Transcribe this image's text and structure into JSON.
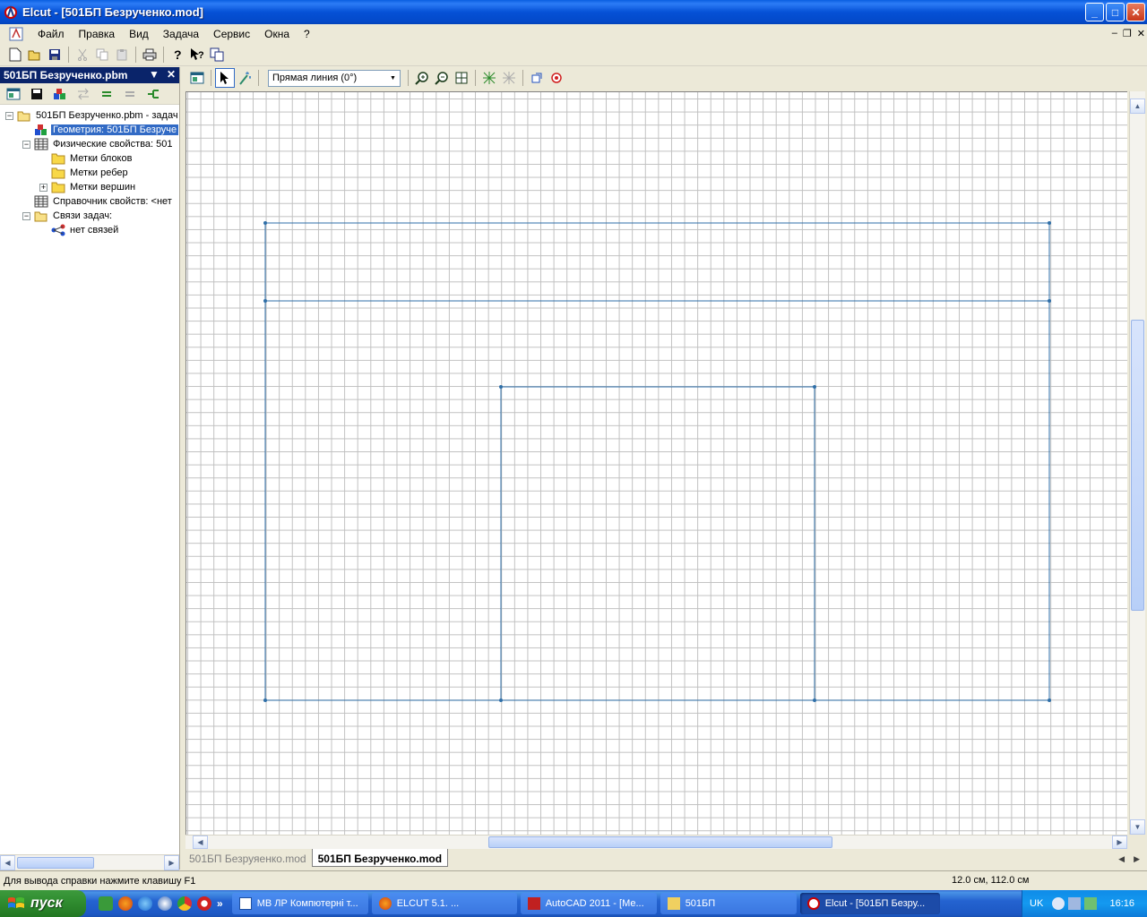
{
  "window": {
    "title": "Elcut - [501БП Безрученко.mod]",
    "controls": {
      "minimize": "_",
      "maximize": "□",
      "close": "✕"
    }
  },
  "menu": {
    "items": [
      "Файл",
      "Правка",
      "Вид",
      "Задача",
      "Сервис",
      "Окна",
      "?"
    ],
    "mdi_controls": {
      "minimize": "–",
      "restore": "❐",
      "close": "✕"
    }
  },
  "left_panel": {
    "title": "501БП Безрученко.pbm",
    "tree": [
      {
        "label": "501БП Безрученко.pbm - задач",
        "level": 0,
        "expander": "−",
        "icon": "folder-open-icon"
      },
      {
        "label": "Геометрия: 501БП Безруче",
        "level": 1,
        "expander": "",
        "icon": "geometry-icon",
        "selected": true
      },
      {
        "label": "Физические свойства: 501",
        "level": 1,
        "expander": "−",
        "icon": "table-icon"
      },
      {
        "label": "Метки блоков",
        "level": 2,
        "expander": "",
        "icon": "folder-icon"
      },
      {
        "label": "Метки ребер",
        "level": 2,
        "expander": "",
        "icon": "folder-icon"
      },
      {
        "label": "Метки вершин",
        "level": 2,
        "expander": "+",
        "icon": "folder-icon"
      },
      {
        "label": "Справочник свойств: <нет",
        "level": 1,
        "expander": "",
        "icon": "table-icon"
      },
      {
        "label": "Связи задач:",
        "level": 1,
        "expander": "−",
        "icon": "folder-open-icon"
      },
      {
        "label": "нет связей",
        "level": 2,
        "expander": "",
        "icon": "links-icon"
      }
    ]
  },
  "doc_toolbar": {
    "line_type": "Прямая линия (0°)"
  },
  "doc_tabs": [
    {
      "label": "501БП Безруяенко.mod",
      "active": false
    },
    {
      "label": "501БП Безрученко.mod",
      "active": true
    }
  ],
  "status": {
    "help": "Для вывода справки нажмите клавишу F1",
    "coords": "12.0 см, 112.0 см"
  },
  "taskbar": {
    "start": "пуск",
    "quick_launch_more": "»",
    "tasks": [
      {
        "label": "МВ ЛР Компютерні т...",
        "icon": "word-icon",
        "active": false
      },
      {
        "label": "ELCUT 5.1.        ...",
        "icon": "browser-icon",
        "active": false
      },
      {
        "label": "AutoCAD 2011 - [Ме...",
        "icon": "autocad-icon",
        "active": false
      },
      {
        "label": "501БП",
        "icon": "folder-icon",
        "active": false
      },
      {
        "label": "Elcut - [501БП Безру...",
        "icon": "elcut-icon",
        "active": true
      }
    ],
    "tray": {
      "lang": "UK",
      "clock": "16:16"
    }
  },
  "colors": {
    "geometry_line": "#2f6fa8",
    "grid": "#c0c0c0",
    "selection": "#316ac5"
  }
}
